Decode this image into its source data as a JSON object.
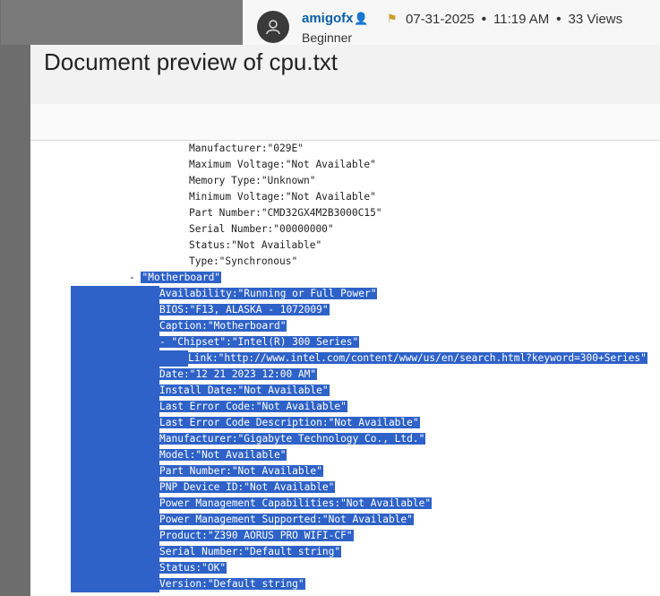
{
  "forum_post": {
    "username": "amigofx",
    "date": "07-31-2025",
    "time": "11:19 AM",
    "views": "33 Views",
    "rank": "Beginner"
  },
  "modal": {
    "title": "Document preview of cpu.txt"
  },
  "document": {
    "lines": [
      {
        "text": "Manufacturer:\"029E\"",
        "highlighted": false
      },
      {
        "text": "Maximum Voltage:\"Not Available\"",
        "highlighted": false
      },
      {
        "text": "Memory Type:\"Unknown\"",
        "highlighted": false
      },
      {
        "text": "Minimum Voltage:\"Not Available\"",
        "highlighted": false
      },
      {
        "text": "Part Number:\"CMD32GX4M2B3000C15\"",
        "highlighted": false
      },
      {
        "text": "Serial Number:\"00000000\"",
        "highlighted": false
      },
      {
        "text": "Status:\"Not Available\"",
        "highlighted": false
      },
      {
        "text": "Type:\"Synchronous\"",
        "highlighted": false
      },
      {
        "prefix": "- ",
        "text": "\"Motherboard\"",
        "highlighted": true
      },
      {
        "text": "Availability:\"Running or Full Power\"",
        "highlighted": true
      },
      {
        "text": "BIOS:\"F13, ALASKA - 1072009\"",
        "highlighted": true
      },
      {
        "text": "Caption:\"Motherboard\"",
        "highlighted": true
      },
      {
        "text": "- \"Chipset\":\"Intel(R) 300 Series\"",
        "highlighted": true
      },
      {
        "text": "Link:\"http://www.intel.com/content/www/us/en/search.html?keyword=300+Series\"",
        "highlighted": true
      },
      {
        "text": "Date:\"12 21 2023 12:00 AM\"",
        "highlighted": true
      },
      {
        "text": "Install Date:\"Not Available\"",
        "highlighted": true
      },
      {
        "text": "Last Error Code:\"Not Available\"",
        "highlighted": true
      },
      {
        "text": "Last Error Code Description:\"Not Available\"",
        "highlighted": true
      },
      {
        "text": "Manufacturer:\"Gigabyte Technology Co., Ltd.\"",
        "highlighted": true
      },
      {
        "text": "Model:\"Not Available\"",
        "highlighted": true
      },
      {
        "text": "Part Number:\"Not Available\"",
        "highlighted": true
      },
      {
        "text": "PNP Device ID:\"Not Available\"",
        "highlighted": true
      },
      {
        "text": "Power Management Capabilities:\"Not Available\"",
        "highlighted": true
      },
      {
        "text": "Power Management Supported:\"Not Available\"",
        "highlighted": true
      },
      {
        "text": "Product:\"Z390 AORUS PRO WIFI-CF\"",
        "highlighted": true
      },
      {
        "text": "Serial Number:\"Default string\"",
        "highlighted": true
      },
      {
        "text": "Status:\"OK\"",
        "highlighted": true
      },
      {
        "text": "Version:\"Default string\"",
        "highlighted": true
      }
    ]
  },
  "colors": {
    "selection": "#2e62c8",
    "username": "#0a5ea8",
    "flag": "#c9a12c"
  },
  "icons": [
    "user-avatar-icon",
    "person-icon",
    "flag-icon"
  ]
}
